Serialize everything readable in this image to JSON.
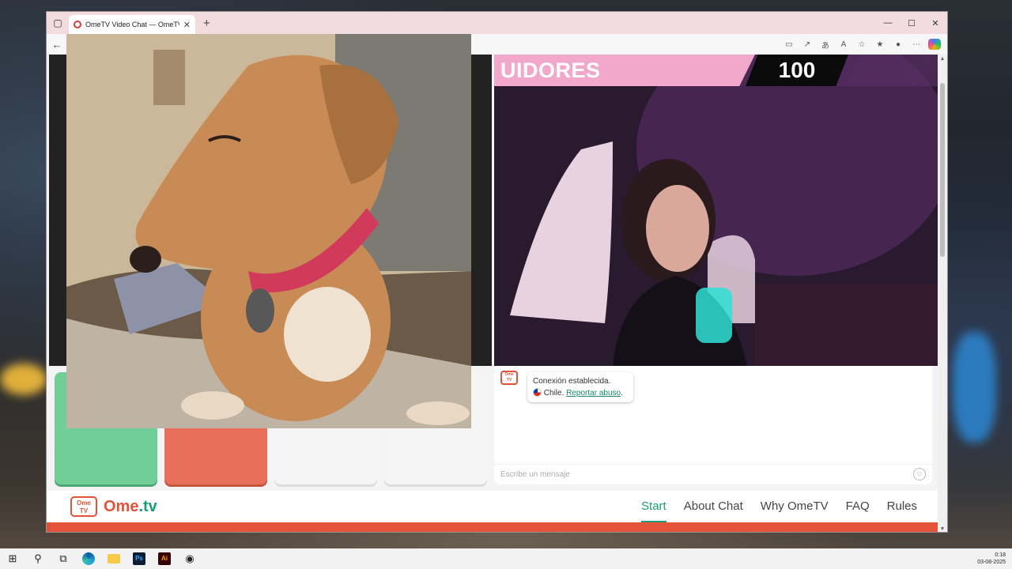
{
  "browser": {
    "tab_title": "OmeTV Video Chat — OmeTV",
    "new_tab": "+",
    "window_controls": {
      "minimize": "—",
      "maximize": "☐",
      "close": "✕"
    },
    "back": "←",
    "tab_close": "✕"
  },
  "remote_video": {
    "overlay_text": "UIDORES",
    "overlay_count": "100"
  },
  "chat": {
    "logo_text": "Ome TV",
    "status": "Conexión establecida.",
    "country": "Chile.",
    "report_link": "Reportar abuso",
    "report_suffix": ".",
    "input_placeholder": "Escribe un mensaje"
  },
  "footer": {
    "logo_icon_text": "Ome TV",
    "logo_main": "Ome",
    "logo_dot": ".tv",
    "nav": [
      {
        "label": "Start",
        "active": true
      },
      {
        "label": "About Chat"
      },
      {
        "label": "Why OmeTV"
      },
      {
        "label": "FAQ"
      },
      {
        "label": "Rules"
      }
    ]
  },
  "controls": {
    "colors": {
      "start": "#6fcf97",
      "stop": "#e8705a",
      "blank": "#f5f5f5"
    }
  },
  "taskbar": {
    "time": "0:18",
    "date": "03-08-2025",
    "ps_label": "Ps",
    "ai_label": "Ai"
  },
  "colors": {
    "brand": "#e2533a",
    "accent": "#1b9e77",
    "banner_pink": "#f2a8cb"
  }
}
